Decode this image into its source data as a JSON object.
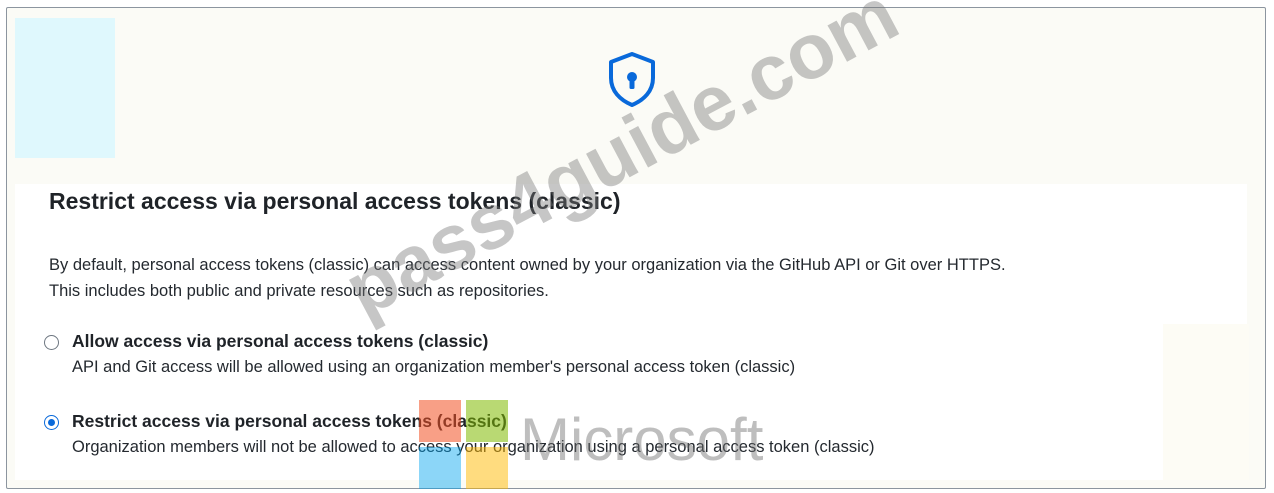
{
  "panel": {
    "title": "Restrict access via personal access tokens (classic)",
    "description": [
      "By default, personal access tokens (classic) can access content owned by your organization via the GitHub API or Git over HTTPS.",
      "This includes both public and private resources such as repositories."
    ],
    "icon": "shield-keyhole-icon",
    "accent_color": "#0969da"
  },
  "options": [
    {
      "label": "Allow access via personal access tokens (classic)",
      "description": "API and Git access will be allowed using an organization member's personal access token (classic)",
      "checked": false
    },
    {
      "label": "Restrict access via personal access tokens (classic)",
      "description": "Organization members will not be allowed to access your organization using a personal access token (classic)",
      "checked": true
    }
  ],
  "watermark": {
    "text": "pass4guide.com",
    "logo_text": "Microsoft"
  }
}
